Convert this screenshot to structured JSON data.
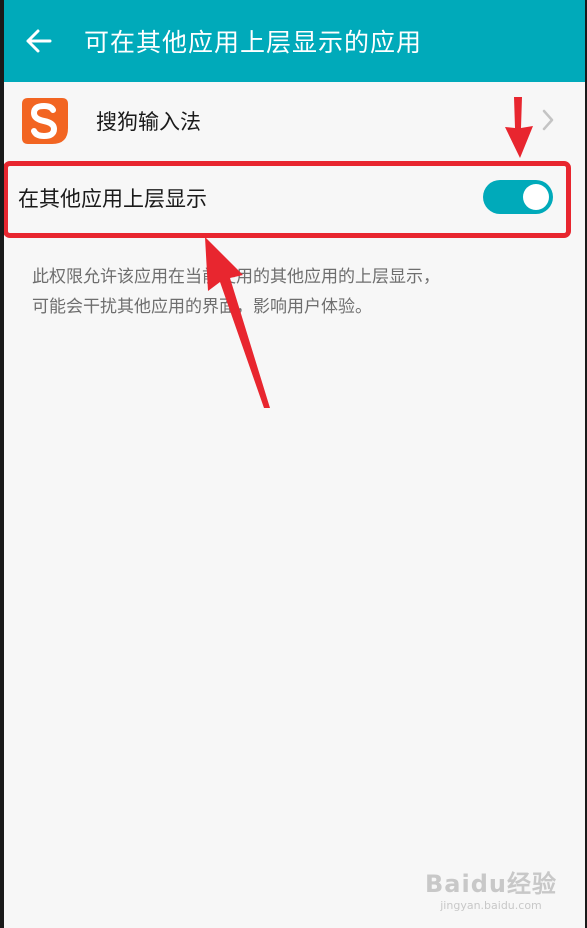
{
  "appbar": {
    "back_icon": "arrow-left-icon",
    "title": "可在其他应用上层显示的应用"
  },
  "app_item": {
    "icon": "sogou-input-icon",
    "name": "搜狗输入法",
    "chevron_icon": "chevron-right-icon"
  },
  "overlay_setting": {
    "label": "在其他应用上层显示",
    "enabled": true
  },
  "description": {
    "line1": "此权限允许该应用在当前使用的其他应用的上层显示，",
    "line2": "可能会干扰其他应用的界面，影响用户体验。"
  },
  "watermark": {
    "logo_text": "Baidu经验",
    "url": "jingyan.baidu.com"
  },
  "colors": {
    "appbar": "#00aaba",
    "toggle_on": "#00aaba",
    "annotation_red": "#e8262f",
    "sogou_orange": "#f26522"
  }
}
